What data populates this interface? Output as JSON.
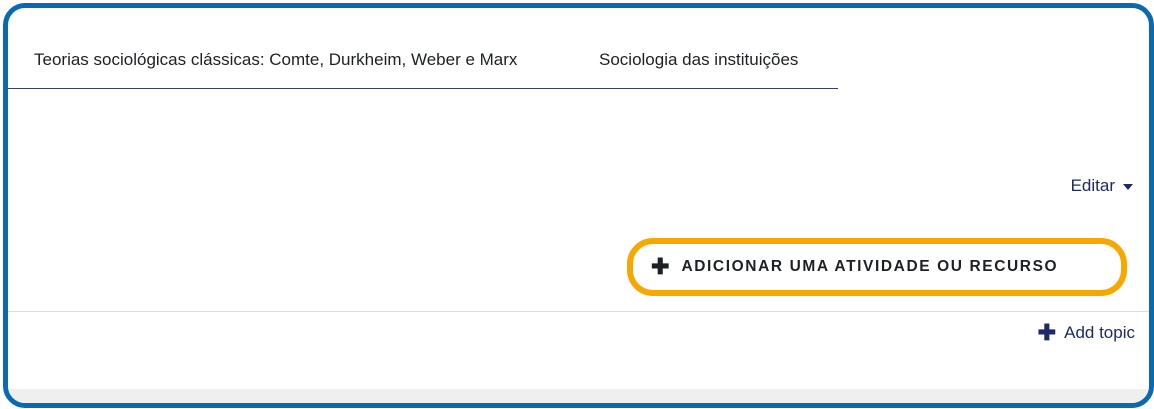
{
  "tabs": [
    {
      "label": "Teorias sociológicas clássicas: Comte, Durkheim, Weber e Marx"
    },
    {
      "label": "Sociologia das instituições"
    }
  ],
  "edit_menu": {
    "label": "Editar"
  },
  "add_activity": {
    "label": "ADICIONAR UMA ATIVIDADE OU RECURSO",
    "icon": "plus-icon"
  },
  "add_topic": {
    "label": "Add topic",
    "icon": "plus-icon"
  },
  "colors": {
    "frame_border": "#0a6ab0",
    "highlight": "#f6a800",
    "link": "#1e2b63"
  }
}
